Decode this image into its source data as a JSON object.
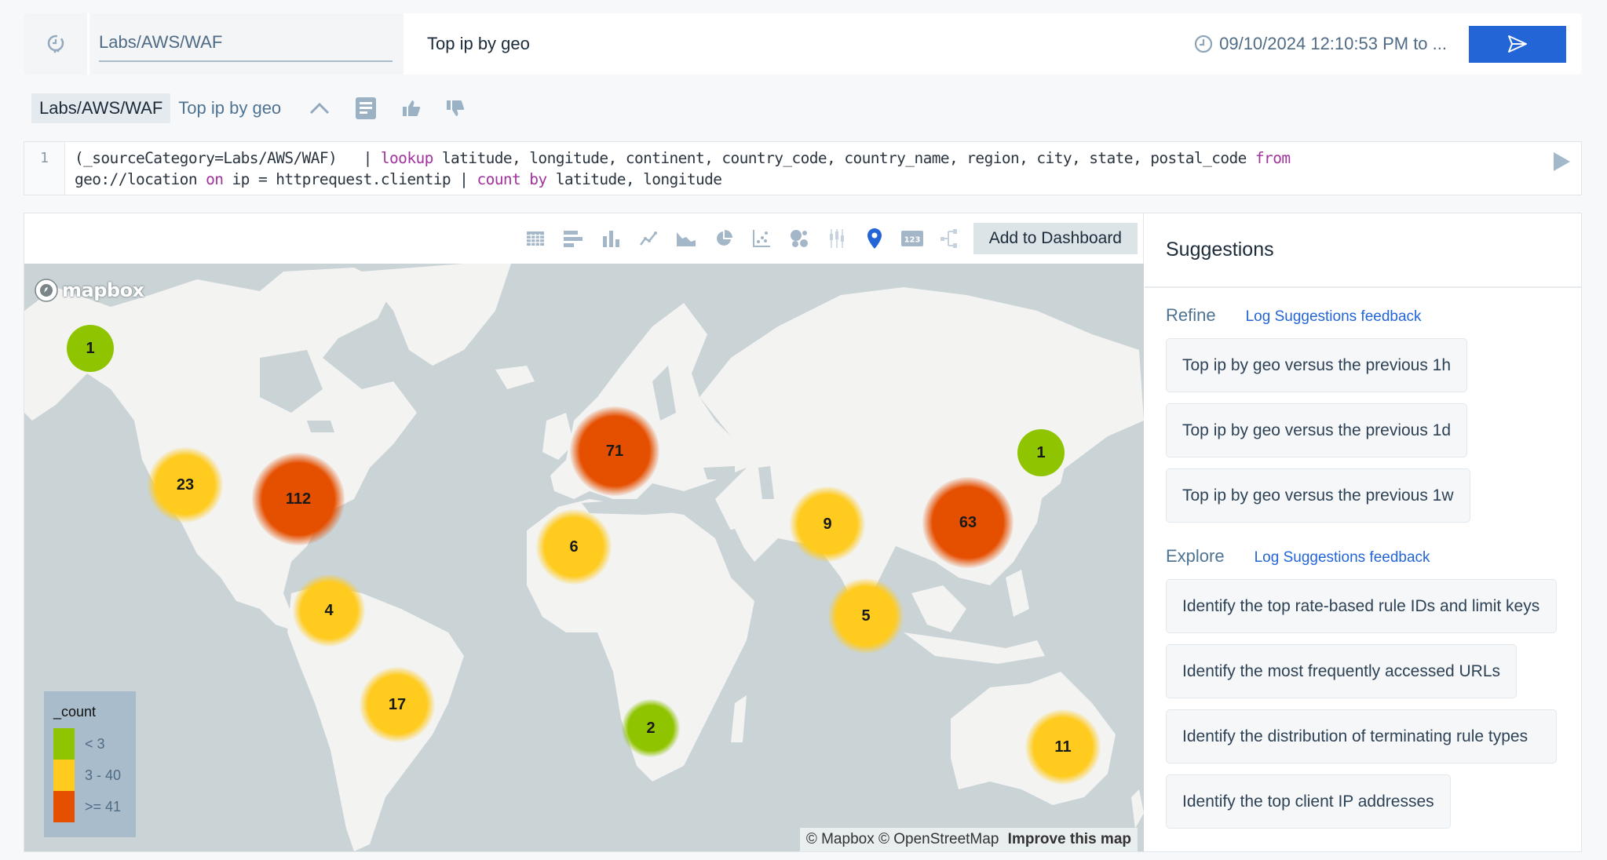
{
  "topbar": {
    "scope_value": "Labs/AWS/WAF",
    "query_value": "Top ip by geo",
    "time_range": "09/10/2024 12:10:53 PM to ..."
  },
  "breadcrumb": {
    "scope": "Labs/AWS/WAF",
    "query": "Top ip by geo"
  },
  "editor": {
    "line_number": "1",
    "line1": [
      {
        "t": "(_sourceCategory=Labs/AWS/WAF)   | ",
        "kw": false
      },
      {
        "t": "lookup",
        "kw": true
      },
      {
        "t": " latitude, longitude, continent, country_code, country_name, region, city, state, postal_code ",
        "kw": false
      },
      {
        "t": "from",
        "kw": true
      }
    ],
    "line2": [
      {
        "t": "geo://location ",
        "kw": false
      },
      {
        "t": "on",
        "kw": true
      },
      {
        "t": " ip = httprequest.clientip | ",
        "kw": false
      },
      {
        "t": "count",
        "kw": true
      },
      {
        "t": " ",
        "kw": false
      },
      {
        "t": "by",
        "kw": true
      },
      {
        "t": " latitude, longitude",
        "kw": false
      }
    ]
  },
  "toolbar": {
    "icons": [
      "table-icon",
      "bar-chart-icon",
      "column-chart-icon",
      "line-chart-icon",
      "area-chart-icon",
      "pie-chart-icon",
      "scatter-chart-icon",
      "bubble-chart-icon",
      "box-plot-icon",
      "map-icon",
      "single-value-icon",
      "sankey-icon"
    ],
    "active_icon": "map-icon",
    "add_to_dashboard": "Add to Dashboard"
  },
  "map": {
    "logo": "mapbox",
    "attribution": "© Mapbox © OpenStreetMap",
    "improve_link": "Improve this map",
    "legend": {
      "title": "_count",
      "items": [
        {
          "label": "< 3",
          "color": "#8fc400"
        },
        {
          "label": "3 - 40",
          "color": "#ffcb1f"
        },
        {
          "label": ">= 41",
          "color": "#e54f00"
        }
      ]
    },
    "markers": [
      {
        "count": "1",
        "region": "Alaska",
        "level": 0
      },
      {
        "count": "23",
        "region": "US West",
        "level": 1
      },
      {
        "count": "112",
        "region": "US East",
        "level": 2
      },
      {
        "count": "4",
        "region": "Colombia",
        "level": 1
      },
      {
        "count": "17",
        "region": "Brazil",
        "level": 1
      },
      {
        "count": "71",
        "region": "Europe",
        "level": 2
      },
      {
        "count": "6",
        "region": "West Africa",
        "level": 1
      },
      {
        "count": "2",
        "region": "South Africa",
        "level": 0
      },
      {
        "count": "9",
        "region": "India",
        "level": 1
      },
      {
        "count": "5",
        "region": "Singapore",
        "level": 1
      },
      {
        "count": "63",
        "region": "China",
        "level": 2
      },
      {
        "count": "1",
        "region": "Japan",
        "level": 0
      },
      {
        "count": "11",
        "region": "Australia",
        "level": 1
      }
    ]
  },
  "suggestions": {
    "title": "Suggestions",
    "refine": {
      "title": "Refine",
      "feedback": "Log Suggestions feedback",
      "items": [
        "Top ip by geo versus the previous 1h",
        "Top ip by geo versus the previous 1d",
        "Top ip by geo versus the previous 1w"
      ]
    },
    "explore": {
      "title": "Explore",
      "feedback": "Log Suggestions feedback",
      "items": [
        "Identify the top rate-based rule IDs and limit keys",
        "Identify the most frequently accessed URLs",
        "Identify the distribution of terminating rule types",
        "Identify the top client IP addresses"
      ]
    }
  }
}
